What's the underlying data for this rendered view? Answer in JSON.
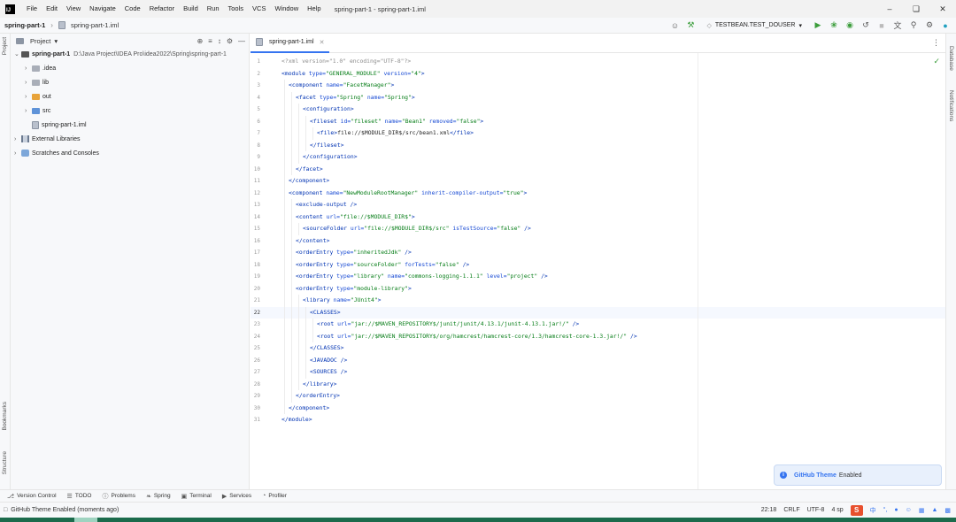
{
  "menubar": {
    "items": [
      "File",
      "Edit",
      "View",
      "Navigate",
      "Code",
      "Refactor",
      "Build",
      "Run",
      "Tools",
      "VCS",
      "Window",
      "Help"
    ],
    "window_title": "spring-part-1 - spring-part-1.iml"
  },
  "navbar": {
    "project": "spring-part-1",
    "file": "spring-part-1.iml",
    "run_config": "TESTBEAN.TEST_DOUSER"
  },
  "project_panel": {
    "title": "Project",
    "tree": [
      {
        "label": "spring-part-1",
        "path": "D:\\Java Project\\IDEA Pro\\idea2022\\Spring\\spring-part-1",
        "indent": 0,
        "expanded": true,
        "icon": "folder-dark"
      },
      {
        "label": ".idea",
        "indent": 1,
        "expanded": false,
        "icon": "folder"
      },
      {
        "label": "lib",
        "indent": 1,
        "expanded": false,
        "icon": "folder"
      },
      {
        "label": "out",
        "indent": 1,
        "expanded": false,
        "icon": "folder-orange"
      },
      {
        "label": "src",
        "indent": 1,
        "expanded": false,
        "icon": "folder-blue"
      },
      {
        "label": "spring-part-1.iml",
        "indent": 1,
        "expanded": null,
        "icon": "iml-file"
      },
      {
        "label": "External Libraries",
        "indent": 0,
        "expanded": false,
        "icon": "library"
      },
      {
        "label": "Scratches and Consoles",
        "indent": 0,
        "expanded": false,
        "icon": "scratch"
      }
    ]
  },
  "editor": {
    "tab": "spring-part-1.iml",
    "current_line": 22,
    "lines": [
      {
        "indent": 0,
        "parts": [
          [
            "cm",
            "<?xml version=\"1.0\" encoding=\"UTF-8\"?>"
          ]
        ]
      },
      {
        "indent": 0,
        "parts": [
          [
            "tg",
            "<module "
          ],
          [
            "at",
            "type="
          ],
          [
            "vl",
            "\"GENERAL_MODULE\" "
          ],
          [
            "at",
            "version="
          ],
          [
            "vl",
            "\"4\""
          ],
          [
            "tg",
            ">"
          ]
        ]
      },
      {
        "indent": 1,
        "parts": [
          [
            "tg",
            "<component "
          ],
          [
            "at",
            "name="
          ],
          [
            "vl",
            "\"FacetManager\""
          ],
          [
            "tg",
            ">"
          ]
        ]
      },
      {
        "indent": 2,
        "parts": [
          [
            "tg",
            "<facet "
          ],
          [
            "at",
            "type="
          ],
          [
            "vl",
            "\"Spring\" "
          ],
          [
            "at",
            "name="
          ],
          [
            "vl",
            "\"Spring\""
          ],
          [
            "tg",
            ">"
          ]
        ]
      },
      {
        "indent": 3,
        "parts": [
          [
            "tg",
            "<configuration>"
          ]
        ]
      },
      {
        "indent": 4,
        "parts": [
          [
            "tg",
            "<fileset "
          ],
          [
            "at",
            "id="
          ],
          [
            "vl",
            "\"fileset\" "
          ],
          [
            "at",
            "name="
          ],
          [
            "vl",
            "\"Bean1\" "
          ],
          [
            "at",
            "removed="
          ],
          [
            "vl",
            "\"false\""
          ],
          [
            "tg",
            ">"
          ]
        ]
      },
      {
        "indent": 5,
        "parts": [
          [
            "tg",
            "<file>"
          ],
          [
            "tx",
            "file://$MODULE_DIR$/src/bean1.xml"
          ],
          [
            "tg",
            "</file>"
          ]
        ]
      },
      {
        "indent": 4,
        "parts": [
          [
            "tg",
            "</fileset>"
          ]
        ]
      },
      {
        "indent": 3,
        "parts": [
          [
            "tg",
            "</configuration>"
          ]
        ]
      },
      {
        "indent": 2,
        "parts": [
          [
            "tg",
            "</facet>"
          ]
        ]
      },
      {
        "indent": 1,
        "parts": [
          [
            "tg",
            "</component>"
          ]
        ]
      },
      {
        "indent": 1,
        "parts": [
          [
            "tg",
            "<component "
          ],
          [
            "at",
            "name="
          ],
          [
            "vl",
            "\"NewModuleRootManager\" "
          ],
          [
            "at",
            "inherit-compiler-output="
          ],
          [
            "vl",
            "\"true\""
          ],
          [
            "tg",
            ">"
          ]
        ]
      },
      {
        "indent": 2,
        "parts": [
          [
            "tg",
            "<exclude-output />"
          ]
        ]
      },
      {
        "indent": 2,
        "parts": [
          [
            "tg",
            "<content "
          ],
          [
            "at",
            "url="
          ],
          [
            "vl",
            "\"file://$MODULE_DIR$\""
          ],
          [
            "tg",
            ">"
          ]
        ]
      },
      {
        "indent": 3,
        "parts": [
          [
            "tg",
            "<sourceFolder "
          ],
          [
            "at",
            "url="
          ],
          [
            "vl",
            "\"file://$MODULE_DIR$/src\" "
          ],
          [
            "at",
            "isTestSource="
          ],
          [
            "vl",
            "\"false\" "
          ],
          [
            "tg",
            "/>"
          ]
        ]
      },
      {
        "indent": 2,
        "parts": [
          [
            "tg",
            "</content>"
          ]
        ]
      },
      {
        "indent": 2,
        "parts": [
          [
            "tg",
            "<orderEntry "
          ],
          [
            "at",
            "type="
          ],
          [
            "vl",
            "\"inheritedJdk\" "
          ],
          [
            "tg",
            "/>"
          ]
        ]
      },
      {
        "indent": 2,
        "parts": [
          [
            "tg",
            "<orderEntry "
          ],
          [
            "at",
            "type="
          ],
          [
            "vl",
            "\"sourceFolder\" "
          ],
          [
            "at",
            "forTests="
          ],
          [
            "vl",
            "\"false\" "
          ],
          [
            "tg",
            "/>"
          ]
        ]
      },
      {
        "indent": 2,
        "parts": [
          [
            "tg",
            "<orderEntry "
          ],
          [
            "at",
            "type="
          ],
          [
            "vl",
            "\"library\" "
          ],
          [
            "at",
            "name="
          ],
          [
            "vl",
            "\"commons-logging-1.1.1\" "
          ],
          [
            "at",
            "level="
          ],
          [
            "vl",
            "\"project\" "
          ],
          [
            "tg",
            "/>"
          ]
        ]
      },
      {
        "indent": 2,
        "parts": [
          [
            "tg",
            "<orderEntry "
          ],
          [
            "at",
            "type="
          ],
          [
            "vl",
            "\"module-library\""
          ],
          [
            "tg",
            ">"
          ]
        ]
      },
      {
        "indent": 3,
        "parts": [
          [
            "tg",
            "<library "
          ],
          [
            "at",
            "name="
          ],
          [
            "vl",
            "\"JUnit4\""
          ],
          [
            "tg",
            ">"
          ]
        ]
      },
      {
        "indent": 4,
        "parts": [
          [
            "tg",
            "<CLASSES>"
          ]
        ]
      },
      {
        "indent": 5,
        "parts": [
          [
            "tg",
            "<root "
          ],
          [
            "at",
            "url="
          ],
          [
            "vl",
            "\"jar://$MAVEN_REPOSITORY$/junit/junit/4.13.1/junit-4.13.1.jar!/\" "
          ],
          [
            "tg",
            "/>"
          ]
        ]
      },
      {
        "indent": 5,
        "parts": [
          [
            "tg",
            "<root "
          ],
          [
            "at",
            "url="
          ],
          [
            "vl",
            "\"jar://$MAVEN_REPOSITORY$/org/hamcrest/hamcrest-core/1.3/hamcrest-core-1.3.jar!/\" "
          ],
          [
            "tg",
            "/>"
          ]
        ]
      },
      {
        "indent": 4,
        "parts": [
          [
            "tg",
            "</CLASSES>"
          ]
        ]
      },
      {
        "indent": 4,
        "parts": [
          [
            "tg",
            "<JAVADOC />"
          ]
        ]
      },
      {
        "indent": 4,
        "parts": [
          [
            "tg",
            "<SOURCES />"
          ]
        ]
      },
      {
        "indent": 3,
        "parts": [
          [
            "tg",
            "</library>"
          ]
        ]
      },
      {
        "indent": 2,
        "parts": [
          [
            "tg",
            "</orderEntry>"
          ]
        ]
      },
      {
        "indent": 1,
        "parts": [
          [
            "tg",
            "</component>"
          ]
        ]
      },
      {
        "indent": 0,
        "parts": [
          [
            "tg",
            "</module>"
          ]
        ]
      }
    ]
  },
  "side_strips": {
    "left_top": "Project",
    "left_bookmarks": "Bookmarks",
    "left_structure": "Structure",
    "right_database": "Database",
    "right_notifications": "Notifications"
  },
  "notification": {
    "theme": "GitHub Theme",
    "text": "Enabled"
  },
  "bottom_tools": [
    "Version Control",
    "TODO",
    "Problems",
    "Spring",
    "Terminal",
    "Services",
    "Profiler"
  ],
  "status": {
    "message": "GitHub Theme Enabled (moments ago)",
    "position": "22:18",
    "line_sep": "CRLF",
    "encoding": "UTF-8",
    "indent": "4 sp",
    "ime_logo": "S",
    "ime_lang": "中"
  },
  "colors": {
    "accent": "#3574f0",
    "tag": "#0033b3",
    "attribute": "#174ad4",
    "value": "#067d17",
    "run": "#3b9d3b"
  }
}
